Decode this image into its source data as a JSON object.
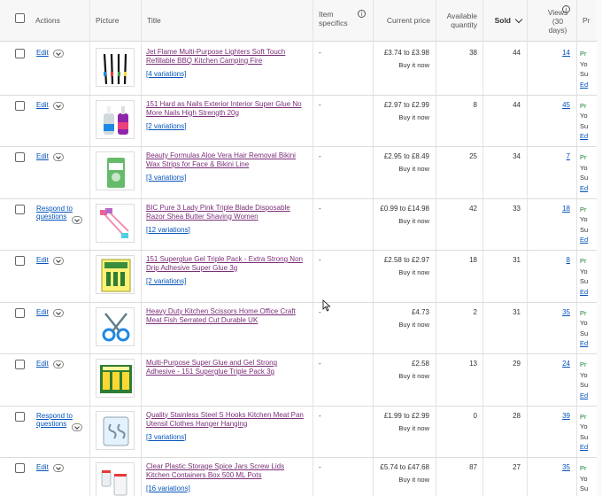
{
  "header": {
    "actions": "Actions",
    "picture": "Picture",
    "title": "Title",
    "item_specifics": "Item specifics",
    "current_price": "Current price",
    "available_quantity": "Available quantity",
    "sold": "Sold",
    "views": "Views (30 days)",
    "truncated": "Pr"
  },
  "rows": [
    {
      "action": "Edit",
      "title": "Jet Flame Multi-Purpose Lighters Soft Touch Refillable BBQ Kitchen Camping Fire",
      "variations": "[4 variations]",
      "specifics": "-",
      "price": "£3.74 to £3.98",
      "price_type": "Buy it now",
      "qty": "38",
      "sold": "44",
      "views": "14"
    },
    {
      "action": "Edit",
      "title": "151 Hard as Nails Exterior Interior Super Glue No More Nails High Strength 20g",
      "variations": "[2 variations]",
      "specifics": "-",
      "price": "£2.97 to £2.99",
      "price_type": "Buy it now",
      "qty": "8",
      "sold": "44",
      "views": "45"
    },
    {
      "action": "Edit",
      "title": "Beauty Formulas Aloe Vera Hair Removal Bikini Wax Strips for Face & Bikini Line",
      "variations": "[3 variations]",
      "specifics": "-",
      "price": "£2.95 to £8.49",
      "price_type": "Buy it now",
      "qty": "25",
      "sold": "34",
      "views": "7"
    },
    {
      "action": "Respond to questions",
      "title": "BIC Pure 3 Lady Pink Triple Blade Disposable Razor Shea Butter Shaving Women",
      "variations": "[12 variations]",
      "specifics": "-",
      "price": "£0.99 to £14.98",
      "price_type": "Buy it now",
      "qty": "42",
      "sold": "33",
      "views": "18"
    },
    {
      "action": "Edit",
      "title": "151 Superglue Gel Triple Pack - Extra Strong Non Drip Adhesive Super Glue 3g",
      "variations": "[2 variations]",
      "specifics": "-",
      "price": "£2.58 to £2.97",
      "price_type": "Buy it now",
      "qty": "18",
      "sold": "31",
      "views": "8"
    },
    {
      "action": "Edit",
      "title": "Heavy Duty Kitchen Scissors Home Office Craft Meat Fish Serrated Cut Durable UK",
      "variations": "",
      "specifics": "-",
      "price": "£4.73",
      "price_type": "Buy it now",
      "qty": "2",
      "sold": "31",
      "views": "35"
    },
    {
      "action": "Edit",
      "title": "Multi-Purpose Super Glue and Gel Strong Adhesive - 151 Superglue Triple Pack 3g",
      "variations": "",
      "specifics": "-",
      "price": "£2.58",
      "price_type": "Buy it now",
      "qty": "13",
      "sold": "29",
      "views": "24"
    },
    {
      "action": "Respond to questions",
      "title": "Quality Stainless Steel S Hooks Kitchen Meat Pan Utensil Clothes Hanger Hanging",
      "variations": "[3 variations]",
      "specifics": "-",
      "price": "£1.99 to £2.99",
      "price_type": "Buy it now",
      "qty": "0",
      "sold": "28",
      "views": "39"
    },
    {
      "action": "Edit",
      "title": "Clear Plastic Storage Spice Jars Screw Lids Kitchen Containers Box 500 ML Pots",
      "variations": "[16 variations]",
      "specifics": "-",
      "price": "£5.74 to £47.68",
      "price_type": "Buy it now",
      "qty": "87",
      "sold": "27",
      "views": "35"
    }
  ],
  "truncated_col": {
    "line1": "Pr",
    "line2": "Yo",
    "line3": "Su",
    "line4": "Ed"
  },
  "colors": {
    "link": "#0654ba",
    "visited": "#7a2e78",
    "header_bg": "#f7f7f7"
  }
}
